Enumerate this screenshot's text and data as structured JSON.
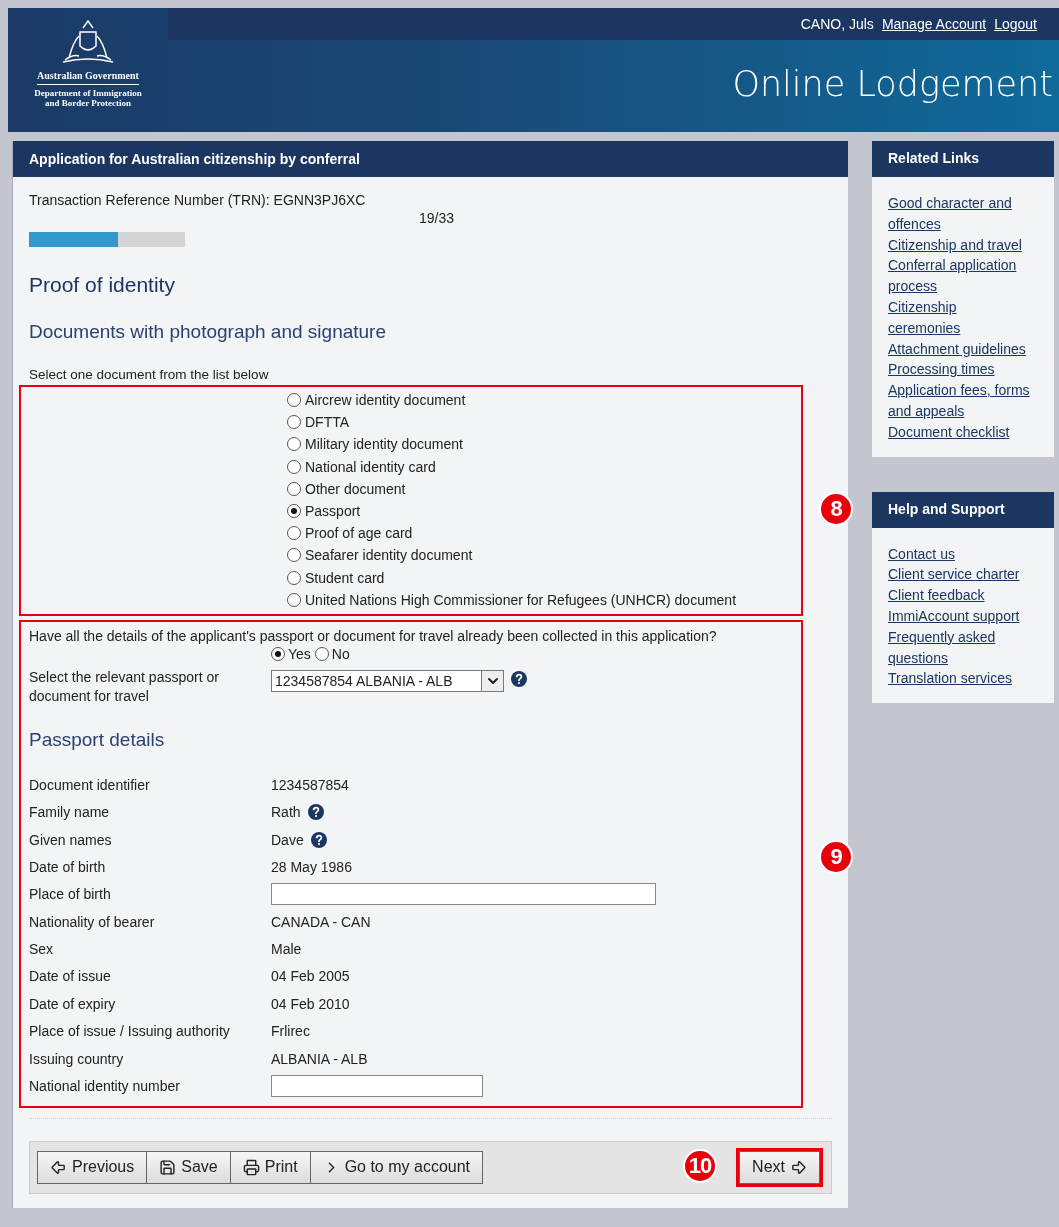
{
  "header": {
    "agency": "Australian Government",
    "department": "Department of Immigration and Border Protection",
    "user": "CANO, Juls",
    "links": [
      "Manage Account",
      "Logout"
    ],
    "title": "Online Lodgement"
  },
  "form": {
    "title": "Application for Australian citizenship by conferral",
    "trn": "Transaction Reference Number (TRN): EGNN3PJ6XC",
    "progress": {
      "reading": "19/33",
      "level": 0.57
    },
    "heading": "Proof of identity",
    "subheading": "Documents with photograph and signature",
    "instruction": "Select one document from the list below",
    "documents": [
      {
        "label": "Aircrew identity document",
        "selected": false
      },
      {
        "label": "DFTTA",
        "selected": false
      },
      {
        "label": "Military identity document",
        "selected": false
      },
      {
        "label": "National identity card",
        "selected": false
      },
      {
        "label": "Other document",
        "selected": false
      },
      {
        "label": "Passport",
        "selected": true
      },
      {
        "label": "Proof of age card",
        "selected": false
      },
      {
        "label": "Seafarer identity document",
        "selected": false
      },
      {
        "label": "Student card",
        "selected": false
      },
      {
        "label": "United Nations High Commissioner for Refugees (UNHCR) document",
        "selected": false
      }
    ],
    "question": {
      "text": "Have all the details of the applicant's passport or document for travel already been collected in this application?",
      "options": [
        {
          "label": "Yes",
          "selected": true
        },
        {
          "label": "No",
          "selected": false
        }
      ]
    },
    "passport_select": {
      "label": "Select the relevant passport or document for travel",
      "value": "1234587854 ALBANIA - ALB"
    },
    "details_heading": "Passport details",
    "details": [
      {
        "label": "Document identifier",
        "kind": "text",
        "value": "1234587854",
        "help": false
      },
      {
        "label": "Family name",
        "kind": "text",
        "value": "Rath",
        "help": true
      },
      {
        "label": "Given names",
        "kind": "text",
        "value": "Dave",
        "help": true
      },
      {
        "label": "Date of birth",
        "kind": "text",
        "value": "28 May 1986",
        "help": false
      },
      {
        "label": "Place of birth",
        "kind": "long_input"
      },
      {
        "label": "Nationality of bearer",
        "kind": "text",
        "value": "CANADA - CAN",
        "help": false
      },
      {
        "label": "Sex",
        "kind": "text",
        "value": "Male",
        "help": false
      },
      {
        "label": "Date of issue",
        "kind": "text",
        "value": "04 Feb 2005",
        "help": false
      },
      {
        "label": "Date of expiry",
        "kind": "text",
        "value": "04 Feb 2010",
        "help": false
      },
      {
        "label": "Place of issue / Issuing authority",
        "kind": "text",
        "value": "Frlirec",
        "help": false
      },
      {
        "label": "Issuing country",
        "kind": "text",
        "value": "ALBANIA - ALB",
        "help": false
      },
      {
        "label": "National identity number",
        "kind": "short_input"
      }
    ],
    "buttons": [
      {
        "label": "Previous",
        "kind": "previous"
      },
      {
        "label": "Save",
        "kind": "save"
      },
      {
        "label": "Print",
        "kind": "print"
      },
      {
        "label": "Go to my account",
        "kind": "account"
      }
    ],
    "next_button": "Next"
  },
  "annotations": [
    "8",
    "9",
    "10"
  ],
  "sidebar": [
    {
      "title": "Related Links",
      "links": [
        "Good character and offences",
        "Citizenship and travel",
        "Conferral application process",
        "Citizenship ceremonies",
        "Attachment guidelines",
        "Processing times",
        "Application fees, forms and appeals",
        "Document checklist"
      ]
    },
    {
      "title": "Help and Support",
      "links": [
        "Contact us",
        "Client service charter",
        "Client feedback",
        "ImmiAccount support",
        "Frequently asked questions",
        "Translation services"
      ]
    }
  ]
}
